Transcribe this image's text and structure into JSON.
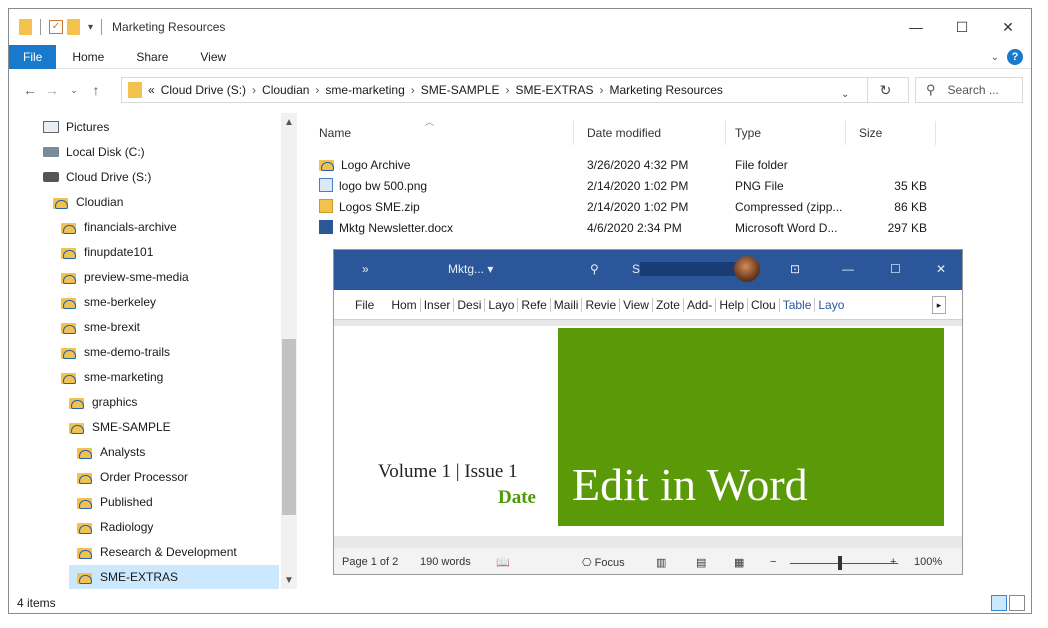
{
  "window": {
    "title": "Marketing Resources"
  },
  "ribbon": {
    "tabs": [
      "File",
      "Home",
      "Share",
      "View"
    ]
  },
  "address": {
    "overflow": "«",
    "crumbs": [
      "Cloud Drive (S:)",
      "Cloudian",
      "sme-marketing",
      "SME-SAMPLE",
      "SME-EXTRAS",
      "Marketing Resources"
    ]
  },
  "search": {
    "placeholder": "Search ..."
  },
  "navpane": {
    "items": [
      {
        "label": "Pictures",
        "icon": "pictures-icon"
      },
      {
        "label": "Local Disk (C:)",
        "icon": "local-disk-icon"
      },
      {
        "label": "Cloud Drive (S:)",
        "icon": "cloud-drive-icon"
      },
      {
        "label": "Cloudian",
        "icon": "cloud-folder-icon"
      },
      {
        "label": "financials-archive",
        "icon": "cloud-folder-icon"
      },
      {
        "label": "finupdate101",
        "icon": "cloud-folder-icon"
      },
      {
        "label": "preview-sme-media",
        "icon": "cloud-folder-icon"
      },
      {
        "label": "sme-berkeley",
        "icon": "cloud-folder-icon"
      },
      {
        "label": "sme-brexit",
        "icon": "cloud-folder-icon"
      },
      {
        "label": "sme-demo-trails",
        "icon": "cloud-folder-icon"
      },
      {
        "label": "sme-marketing",
        "icon": "cloud-folder-icon"
      },
      {
        "label": "graphics",
        "icon": "cloud-folder-icon"
      },
      {
        "label": "SME-SAMPLE",
        "icon": "cloud-folder-icon"
      },
      {
        "label": "Analysts",
        "icon": "cloud-folder-icon"
      },
      {
        "label": "Order Processor",
        "icon": "cloud-folder-icon"
      },
      {
        "label": "Published",
        "icon": "cloud-folder-icon"
      },
      {
        "label": "Radiology",
        "icon": "cloud-folder-icon"
      },
      {
        "label": "Research & Development",
        "icon": "cloud-folder-icon"
      },
      {
        "label": "SME-EXTRAS",
        "icon": "cloud-folder-icon",
        "selected": true
      }
    ]
  },
  "filelist": {
    "columns": {
      "name": "Name",
      "date": "Date modified",
      "type": "Type",
      "size": "Size"
    },
    "rows": [
      {
        "name": "Logo Archive",
        "date": "3/26/2020 4:32 PM",
        "type": "File folder",
        "size": "",
        "icon": "cloud-folder-icon"
      },
      {
        "name": "logo bw 500.png",
        "date": "2/14/2020 1:02 PM",
        "type": "PNG File",
        "size": "35 KB",
        "icon": "png-file-icon"
      },
      {
        "name": "Logos SME.zip",
        "date": "2/14/2020 1:02 PM",
        "type": "Compressed (zipp...",
        "size": "86 KB",
        "icon": "zip-file-icon"
      },
      {
        "name": "Mktg Newsletter.docx",
        "date": "4/6/2020 2:34 PM",
        "type": "Microsoft Word D...",
        "size": "297 KB",
        "icon": "word-doc-icon"
      }
    ]
  },
  "status": {
    "item_count": "4 items"
  },
  "word": {
    "expand": "»",
    "doc_title": "Mktg...",
    "user_initial": "St",
    "menu": [
      "File",
      "Hom",
      "Inser",
      "Desi",
      "Layo",
      "Refe",
      "Maili",
      "Revie",
      "View",
      "Zote",
      "Add-",
      "Help",
      "Clou",
      "Table",
      "Layo"
    ],
    "menu_blue": [
      13,
      14
    ],
    "page": {
      "headline": "Edit in Word",
      "volume": "Volume 1 | Issue 1",
      "date_label": "Date"
    },
    "status": {
      "page": "Page 1 of 2",
      "words": "190 words",
      "focus": "Focus",
      "zoom": "100%"
    },
    "colors": {
      "title_bar": "#2b579a",
      "accent_green": "#5a9a08"
    }
  }
}
